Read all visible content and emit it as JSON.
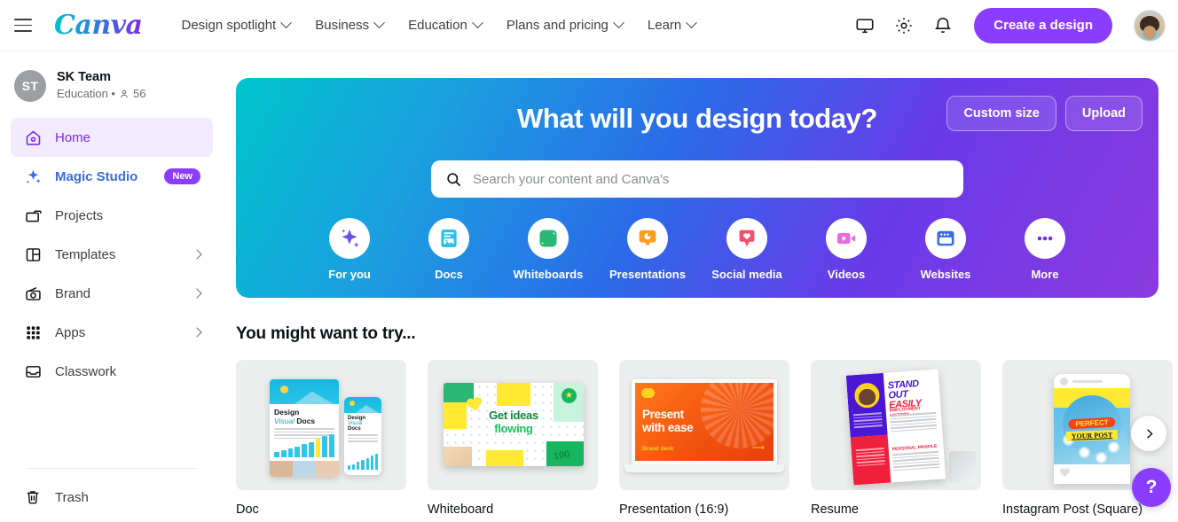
{
  "header": {
    "menu_icon": "hamburger-icon",
    "logo_text": "Canva",
    "nav": [
      {
        "label": "Design spotlight",
        "icon": "chevron-down-icon"
      },
      {
        "label": "Business",
        "icon": "chevron-down-icon"
      },
      {
        "label": "Education",
        "icon": "chevron-down-icon"
      },
      {
        "label": "Plans and pricing",
        "icon": "chevron-down-icon"
      },
      {
        "label": "Learn",
        "icon": "chevron-down-icon"
      }
    ],
    "icons": [
      "monitor-icon",
      "gear-icon",
      "bell-icon"
    ],
    "create_button": "Create a design",
    "avatar": "user-avatar",
    "accent_purple": "#8b3dff"
  },
  "sidebar": {
    "team": {
      "initials": "ST",
      "name": "SK Team",
      "meta": "Education • ",
      "members": "56",
      "member_icon": "person-icon"
    },
    "items": [
      {
        "label": "Home",
        "icon": "home-icon",
        "active": true
      },
      {
        "label": "Magic Studio",
        "icon": "sparkle-icon",
        "badge": "New"
      },
      {
        "label": "Projects",
        "icon": "folder-icon"
      },
      {
        "label": "Templates",
        "icon": "template-icon",
        "chevron": "chevron-right-icon"
      },
      {
        "label": "Brand",
        "icon": "brand-icon",
        "chevron": "chevron-right-icon"
      },
      {
        "label": "Apps",
        "icon": "apps-grid-icon",
        "chevron": "chevron-right-icon"
      },
      {
        "label": "Classwork",
        "icon": "inbox-icon"
      }
    ],
    "trash": {
      "label": "Trash",
      "icon": "trash-icon"
    },
    "active_color": "#7d2ae8",
    "active_bg": "#f2ebfd",
    "magic_color": "#3a6ce0"
  },
  "banner": {
    "title": "What will you design today?",
    "custom_size_button": "Custom size",
    "upload_button": "Upload",
    "search_placeholder": "Search your content and Canva's",
    "search_value": "",
    "search_icon": "search-icon",
    "gradient_from": "#00c4cc",
    "gradient_to": "#8b3ae0",
    "categories": [
      {
        "label": "For you",
        "icon": "sparkle-icon",
        "active": true
      },
      {
        "label": "Docs",
        "icon": "doc-icon",
        "color": "#29c3e8"
      },
      {
        "label": "Whiteboards",
        "icon": "whiteboard-icon",
        "color": "#2bb673"
      },
      {
        "label": "Presentations",
        "icon": "presentation-icon",
        "color": "#f99d1c"
      },
      {
        "label": "Social media",
        "icon": "heart-bubble-icon",
        "color": "#f4506a"
      },
      {
        "label": "Videos",
        "icon": "video-camera-icon",
        "color": "#e86bd8"
      },
      {
        "label": "Websites",
        "icon": "browser-window-icon",
        "color": "#3a6ce0"
      },
      {
        "label": "More",
        "icon": "ellipsis-icon",
        "color": "#7d2ae8"
      }
    ]
  },
  "try_section": {
    "title": "You might want to try...",
    "cards": [
      {
        "label": "Doc",
        "thumb_title": "Design",
        "thumb_title_2": "Visual",
        "thumb_title_3": "Docs"
      },
      {
        "label": "Whiteboard",
        "thumb_line1": "Get ideas",
        "thumb_line2": "flowing",
        "scribble": "100"
      },
      {
        "label": "Presentation (16:9)",
        "thumb_line1": "Present",
        "thumb_line2": "with ease",
        "thumb_sub": "Brand deck"
      },
      {
        "label": "Resume",
        "thumb_line1": "STAND OUT",
        "thumb_line2": "EASILY",
        "section1": "EMPLOYMENT HISTORY",
        "section2": "PERSONAL PROFILE"
      },
      {
        "label": "Instagram Post (Square)",
        "thumb_line1": "PERFECT",
        "thumb_line2": "YOUR POST"
      }
    ],
    "next_icon": "chevron-right-icon"
  },
  "help": {
    "label": "?",
    "icon": "help-icon",
    "color": "#8b3dff"
  }
}
